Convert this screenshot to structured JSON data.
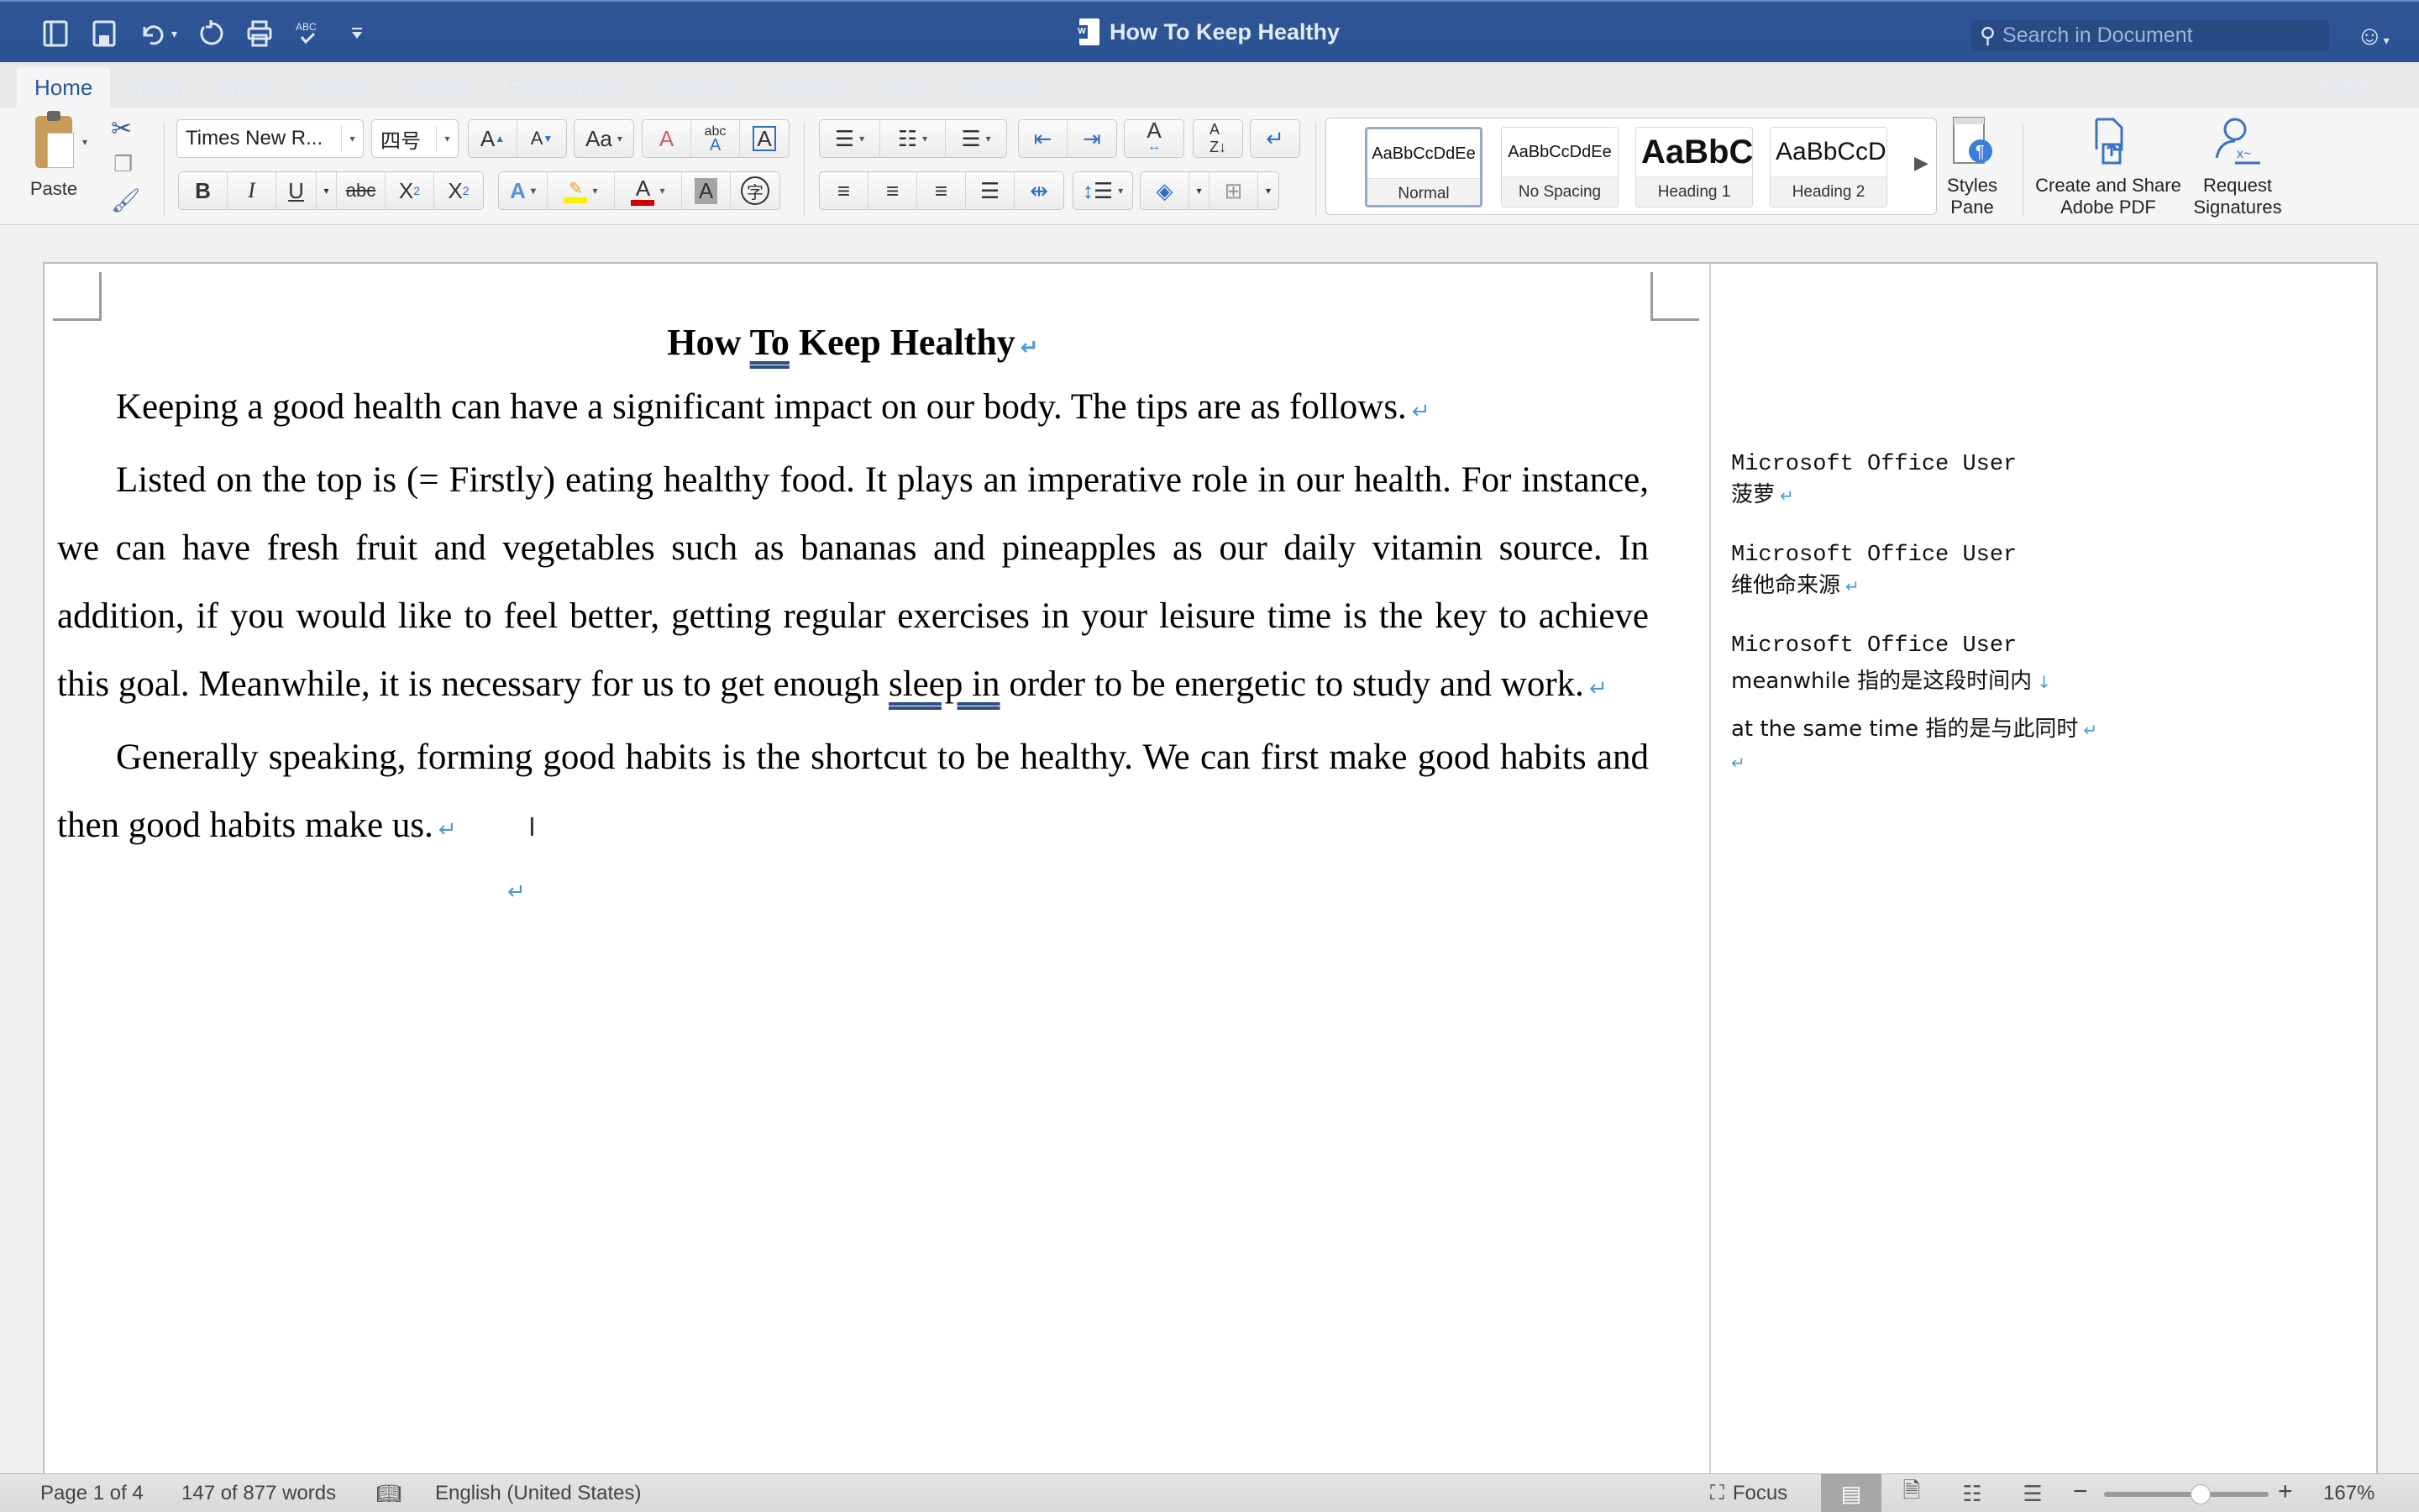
{
  "window": {
    "title": "How To Keep Healthy",
    "search_placeholder": "Search in Document"
  },
  "quick_access": [
    {
      "name": "sidebar-toggle",
      "icon": "sidebar-icon"
    },
    {
      "name": "save",
      "icon": "save-icon"
    },
    {
      "name": "undo",
      "icon": "undo-icon"
    },
    {
      "name": "redo",
      "icon": "redo-icon"
    },
    {
      "name": "print",
      "icon": "print-icon"
    },
    {
      "name": "spelling",
      "icon": "spellcheck-icon"
    },
    {
      "name": "customize",
      "icon": "customize-icon"
    }
  ],
  "tabs": [
    "Home",
    "Insert",
    "Draw",
    "Design",
    "Layout",
    "References",
    "Mailings",
    "Review",
    "View",
    "Acrobat"
  ],
  "active_tab": "Home",
  "share_label": "Share",
  "ribbon": {
    "paste_label": "Paste",
    "font_name": "Times New R...",
    "font_size": "四号",
    "styles": [
      {
        "sample": "AaBbCcDdEe",
        "name": "Normal",
        "active": true
      },
      {
        "sample": "AaBbCcDdEe",
        "name": "No Spacing",
        "active": false
      },
      {
        "sample": "AaBbCc",
        "name": "Heading 1",
        "active": false
      },
      {
        "sample": "AaBbCcDc",
        "name": "Heading 2",
        "active": false
      }
    ],
    "styles_pane": [
      "Styles",
      "Pane"
    ],
    "create_pdf": [
      "Create and Share",
      "Adobe PDF"
    ],
    "request_sign": [
      "Request",
      "Signatures"
    ],
    "highlight_color": "#ffee00",
    "font_color": "#d40000"
  },
  "document": {
    "title_parts": [
      "How ",
      "To",
      " Keep Healthy"
    ],
    "paragraphs": [
      "Keeping a good health can have a significant impact on our body. The tips are as follows.",
      {
        "before": "Listed on the top is (= Firstly) eating healthy food. It plays an imperative role in our health. For instance, we can have fresh fruit and vegetables such as bananas and pineapples as our daily vitamin source. In addition, if you would like to feel better, getting regular exercises in your leisure time is the key to achieve this goal. Meanwhile, it is necessary for us to get enough ",
        "marked": "sleep in",
        "after": " order to be energetic to study and work."
      },
      "Generally speaking, forming good habits is the shortcut to be healthy. We can first make good habits and then good habits make us."
    ],
    "para_mark": "↵"
  },
  "comments": [
    {
      "author": "Microsoft Office User",
      "text": "菠萝"
    },
    {
      "author": "Microsoft Office User",
      "text": "维他命来源"
    },
    {
      "author": "Microsoft Office User",
      "text": "meanwhile 指的是这段时间内",
      "text2": "at the same time 指的是与此同时"
    }
  ],
  "status": {
    "page": "Page 1 of 4",
    "words": "147 of 877 words",
    "language": "English (United States)",
    "focus": "Focus",
    "zoom": "167%",
    "zoom_fraction": 0.6
  },
  "colors": {
    "brand": "#2b579a",
    "para_mark": "#4a9bd6"
  }
}
